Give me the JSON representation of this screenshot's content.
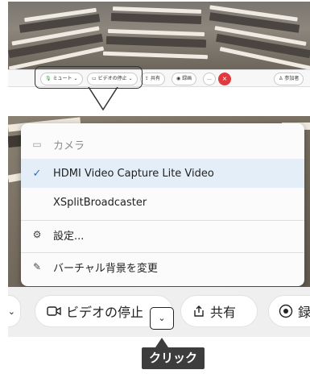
{
  "thumbnail": {
    "toolbar": {
      "mute_label": "ミュート",
      "stop_video_label": "ビデオの停止",
      "share_label": "共有",
      "record_label": "録画",
      "more_label": "…",
      "end_label": "×",
      "participants_label": "参加者"
    }
  },
  "menu": {
    "header": "カメラ",
    "items": [
      {
        "label": "HDMI Video Capture Lite Video",
        "selected": true
      },
      {
        "label": "XSplitBroadcaster",
        "selected": false
      }
    ],
    "settings_label": "設定...",
    "background_label": "バーチャル背景を変更",
    "icons": {
      "camera": "camera-icon",
      "check": "check-icon",
      "settings": "gear-icon",
      "background": "magic-wand-icon"
    }
  },
  "toolbar": {
    "stop_video_label": "ビデオの停止",
    "share_label": "共有",
    "record_label": "録",
    "left_chevron": "⌄",
    "video_chevron": "⌄"
  },
  "annotation": {
    "click_label": "クリック"
  },
  "colors": {
    "accent": "#1e6fd9",
    "selected_bg": "#e4eef8",
    "end_button": "#e0393e",
    "callout_tag": "#3d3d3d"
  }
}
